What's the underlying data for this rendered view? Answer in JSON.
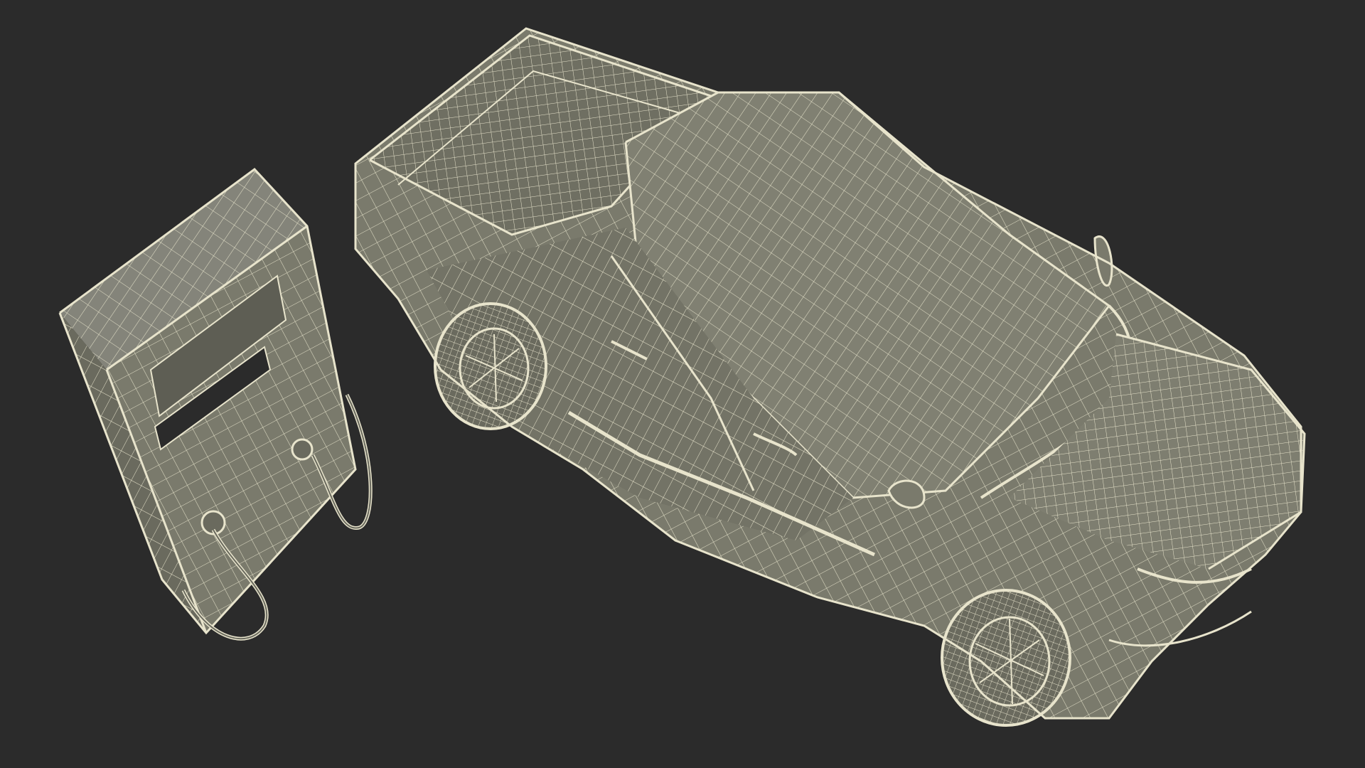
{
  "scene": {
    "background_color": "#2b2b2b",
    "surface_color": "#7c7c6c",
    "surface_shade_color": "#6a6a5c",
    "wire_color": "#e8e4cc",
    "objects": [
      {
        "name": "ev-charging-station",
        "render_style": "wireframe"
      },
      {
        "name": "pickup-truck",
        "render_style": "wireframe"
      }
    ]
  }
}
